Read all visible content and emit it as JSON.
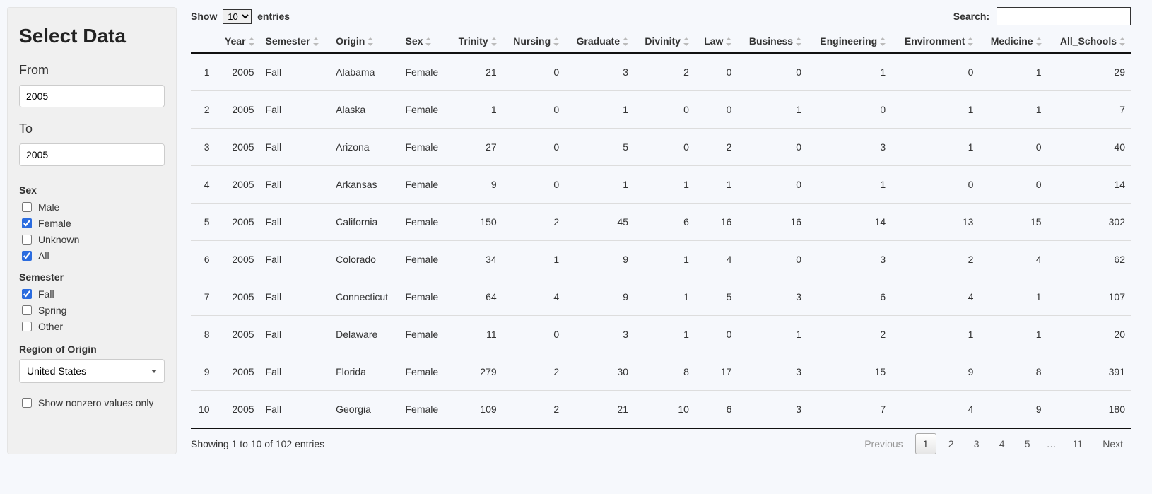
{
  "sidebar": {
    "title": "Select Data",
    "from_label": "From",
    "from_value": "2005",
    "to_label": "To",
    "to_value": "2005",
    "sex_label": "Sex",
    "sex_options": [
      {
        "label": "Male",
        "checked": false
      },
      {
        "label": "Female",
        "checked": true
      },
      {
        "label": "Unknown",
        "checked": false
      },
      {
        "label": "All",
        "checked": true
      }
    ],
    "semester_label": "Semester",
    "semester_options": [
      {
        "label": "Fall",
        "checked": true
      },
      {
        "label": "Spring",
        "checked": false
      },
      {
        "label": "Other",
        "checked": false
      }
    ],
    "region_label": "Region of Origin",
    "region_selected": "United States",
    "nonzero_label": "Show nonzero values only",
    "nonzero_checked": false
  },
  "datatable": {
    "length_prefix": "Show",
    "length_suffix": "entries",
    "length_value": "10",
    "search_label": "Search:",
    "search_value": "",
    "columns": [
      {
        "key": "idx",
        "label": "",
        "numeric": true
      },
      {
        "key": "Year",
        "label": "Year",
        "numeric": true
      },
      {
        "key": "Semester",
        "label": "Semester",
        "numeric": false
      },
      {
        "key": "Origin",
        "label": "Origin",
        "numeric": false
      },
      {
        "key": "Sex",
        "label": "Sex",
        "numeric": false
      },
      {
        "key": "Trinity",
        "label": "Trinity",
        "numeric": true
      },
      {
        "key": "Nursing",
        "label": "Nursing",
        "numeric": true
      },
      {
        "key": "Graduate",
        "label": "Graduate",
        "numeric": true
      },
      {
        "key": "Divinity",
        "label": "Divinity",
        "numeric": true
      },
      {
        "key": "Law",
        "label": "Law",
        "numeric": true
      },
      {
        "key": "Business",
        "label": "Business",
        "numeric": true
      },
      {
        "key": "Engineering",
        "label": "Engineering",
        "numeric": true
      },
      {
        "key": "Environment",
        "label": "Environment",
        "numeric": true
      },
      {
        "key": "Medicine",
        "label": "Medicine",
        "numeric": true
      },
      {
        "key": "All_Schools",
        "label": "All_Schools",
        "numeric": true
      }
    ],
    "rows": [
      {
        "idx": 1,
        "Year": 2005,
        "Semester": "Fall",
        "Origin": "Alabama",
        "Sex": "Female",
        "Trinity": 21,
        "Nursing": 0,
        "Graduate": 3,
        "Divinity": 2,
        "Law": 0,
        "Business": 0,
        "Engineering": 1,
        "Environment": 0,
        "Medicine": 1,
        "All_Schools": 29
      },
      {
        "idx": 2,
        "Year": 2005,
        "Semester": "Fall",
        "Origin": "Alaska",
        "Sex": "Female",
        "Trinity": 1,
        "Nursing": 0,
        "Graduate": 1,
        "Divinity": 0,
        "Law": 0,
        "Business": 1,
        "Engineering": 0,
        "Environment": 1,
        "Medicine": 1,
        "All_Schools": 7
      },
      {
        "idx": 3,
        "Year": 2005,
        "Semester": "Fall",
        "Origin": "Arizona",
        "Sex": "Female",
        "Trinity": 27,
        "Nursing": 0,
        "Graduate": 5,
        "Divinity": 0,
        "Law": 2,
        "Business": 0,
        "Engineering": 3,
        "Environment": 1,
        "Medicine": 0,
        "All_Schools": 40
      },
      {
        "idx": 4,
        "Year": 2005,
        "Semester": "Fall",
        "Origin": "Arkansas",
        "Sex": "Female",
        "Trinity": 9,
        "Nursing": 0,
        "Graduate": 1,
        "Divinity": 1,
        "Law": 1,
        "Business": 0,
        "Engineering": 1,
        "Environment": 0,
        "Medicine": 0,
        "All_Schools": 14
      },
      {
        "idx": 5,
        "Year": 2005,
        "Semester": "Fall",
        "Origin": "California",
        "Sex": "Female",
        "Trinity": 150,
        "Nursing": 2,
        "Graduate": 45,
        "Divinity": 6,
        "Law": 16,
        "Business": 16,
        "Engineering": 14,
        "Environment": 13,
        "Medicine": 15,
        "All_Schools": 302
      },
      {
        "idx": 6,
        "Year": 2005,
        "Semester": "Fall",
        "Origin": "Colorado",
        "Sex": "Female",
        "Trinity": 34,
        "Nursing": 1,
        "Graduate": 9,
        "Divinity": 1,
        "Law": 4,
        "Business": 0,
        "Engineering": 3,
        "Environment": 2,
        "Medicine": 4,
        "All_Schools": 62
      },
      {
        "idx": 7,
        "Year": 2005,
        "Semester": "Fall",
        "Origin": "Connecticut",
        "Sex": "Female",
        "Trinity": 64,
        "Nursing": 4,
        "Graduate": 9,
        "Divinity": 1,
        "Law": 5,
        "Business": 3,
        "Engineering": 6,
        "Environment": 4,
        "Medicine": 1,
        "All_Schools": 107
      },
      {
        "idx": 8,
        "Year": 2005,
        "Semester": "Fall",
        "Origin": "Delaware",
        "Sex": "Female",
        "Trinity": 11,
        "Nursing": 0,
        "Graduate": 3,
        "Divinity": 1,
        "Law": 0,
        "Business": 1,
        "Engineering": 2,
        "Environment": 1,
        "Medicine": 1,
        "All_Schools": 20
      },
      {
        "idx": 9,
        "Year": 2005,
        "Semester": "Fall",
        "Origin": "Florida",
        "Sex": "Female",
        "Trinity": 279,
        "Nursing": 2,
        "Graduate": 30,
        "Divinity": 8,
        "Law": 17,
        "Business": 3,
        "Engineering": 15,
        "Environment": 9,
        "Medicine": 8,
        "All_Schools": 391
      },
      {
        "idx": 10,
        "Year": 2005,
        "Semester": "Fall",
        "Origin": "Georgia",
        "Sex": "Female",
        "Trinity": 109,
        "Nursing": 2,
        "Graduate": 21,
        "Divinity": 10,
        "Law": 6,
        "Business": 3,
        "Engineering": 7,
        "Environment": 4,
        "Medicine": 9,
        "All_Schools": 180
      }
    ],
    "info_text": "Showing 1 to 10 of 102 entries",
    "pagination": {
      "prev": "Previous",
      "next": "Next",
      "pages": [
        "1",
        "2",
        "3",
        "4",
        "5",
        "…",
        "11"
      ],
      "current": "1"
    }
  }
}
